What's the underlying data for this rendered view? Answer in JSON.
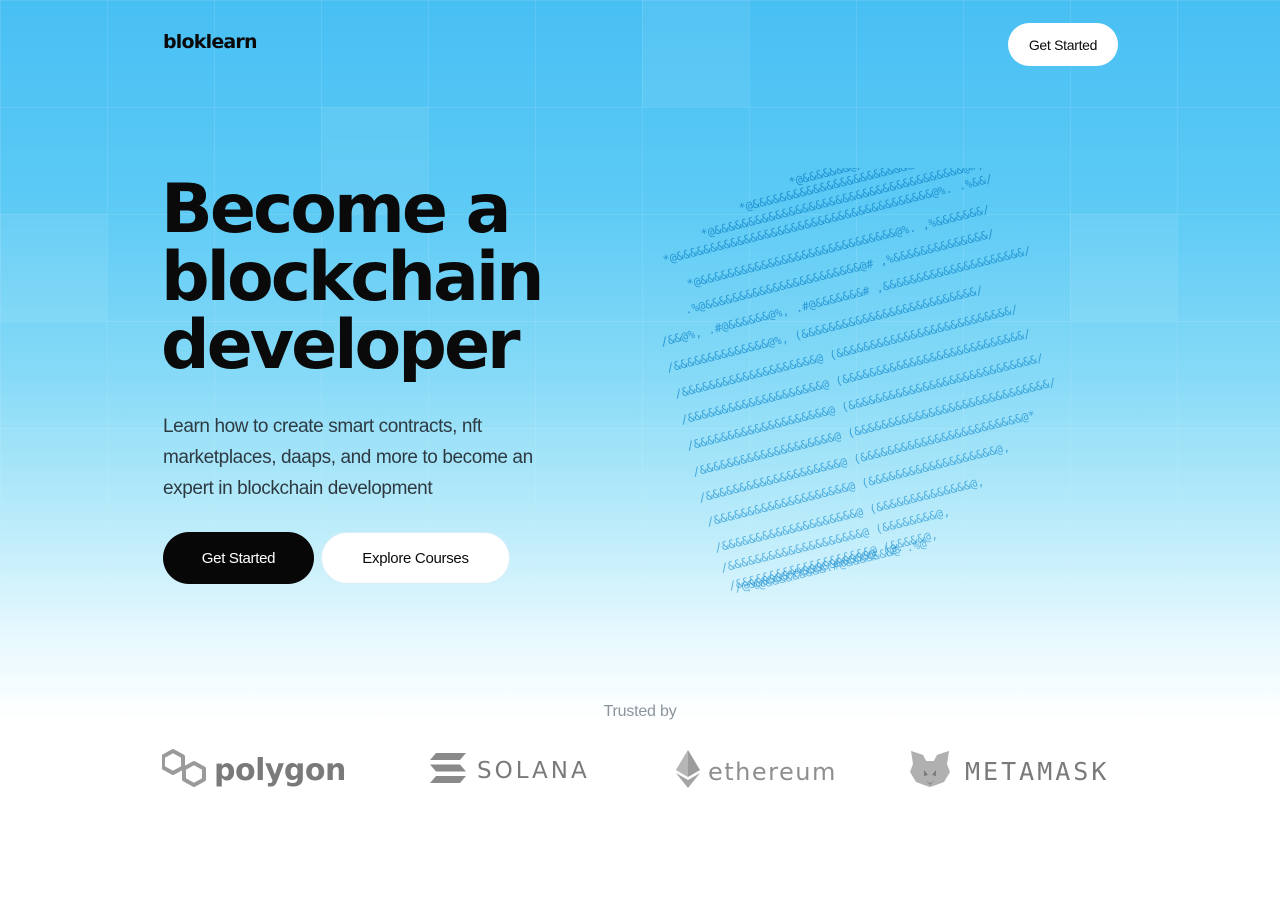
{
  "nav": {
    "logo": "bloklearn",
    "cta_label": "Get Started"
  },
  "hero": {
    "headline_lines": [
      "Become a",
      "blockchain",
      "developer"
    ],
    "subtitle": "Learn how to create smart contracts, nft marketplaces, daaps, and more to become an expert in blockchain development",
    "primary_button": "Get Started",
    "secondary_button": "Explore Courses",
    "art_icon": "ascii-blockchain-cube",
    "art_rows": [
      "*@&&&&&&&@/",
      "*@&&&&&&&&&&&&&&&&&&&&&&&&&&&&@(.",
      "*@&&&&&&&&&&&&&&&&&&&&&&&&&&&&&&&&&&&&&@#,",
      "*@&&&&&&&&&&&&&&&&&&&&&&&&&&&&&&&&&&&&&&@%.  .%&&/",
      "*@&&&&&&&&&&&&&&&&&&&&&&&&&&&&&@%.  ,%&&&&&&&/",
      ".%@&&&&&&&&&&&&&&&&&&&&&&&@#  ,%&&&&&&&&&&&&&&/",
      "/&&@%,  .#@&&&&&&@%,  .#@&&&&&&&#  ,&&&&&&&&&&&&&&&&&&&&&/",
      "/&&&&&&&&&&&&&&@%,   (&&&&&&&&&&&&&&&&&&&&&&&&&&/",
      "/&&&&&&&&&&&&&&&&&&&&@  (&&&&&&&&&&&&&&&&&&&&&&&&&&/",
      "/&&&&&&&&&&&&&&&&&&&&@  (&&&&&&&&&&&&&&&&&&&&&&&&&&&/",
      "/&&&&&&&&&&&&&&&&&&&&@  (&&&&&&&&&&&&&&&&&&&&&&&&&&&&/",
      "/&&&&&&&&&&&&&&&&&&&&@  (&&&&&&&&&&&&&&&&&&&&&&&&&&&&&/",
      "/&&&&&&&&&&&&&&&&&&&&@  (&&&&&&&&&&&&&&&&&&&&&&&&@*",
      "/&&&&&&&&&&&&&&&&&&&&@  (&&&&&&&&&&&&&&&&&&&@,",
      "/&&&&&&&&&&&&&&&&&&&&@  (&&&&&&&&&&&&&&@,",
      "/&&&&&&&&&&&&&&&&&&&&@  (&&&&&&&&@,",
      "/&&&&&&&&&&&&&&&&&&&&@  (&&&&&@,",
      "/@&&&&&&%%&&&&&&&&&&@  (@.",
      ".%@&&&&&&&&&.#@&&&&&&&@  .%@"
    ]
  },
  "trusted": {
    "heading": "Trusted by",
    "logos": [
      {
        "name": "polygon",
        "icon": "polygon-logo-icon"
      },
      {
        "name": "SOLANA",
        "icon": "solana-logo-icon"
      },
      {
        "name": "ethereum",
        "icon": "ethereum-logo-icon"
      },
      {
        "name": "METAMASK",
        "icon": "metamask-fox-icon"
      }
    ]
  },
  "colors": {
    "hero_top": "#48bff3",
    "hero_bottom": "#ffffff",
    "ascii": "#1a8fd0",
    "primary_button": "#070707",
    "logo_gray": "#7a7a7a"
  }
}
